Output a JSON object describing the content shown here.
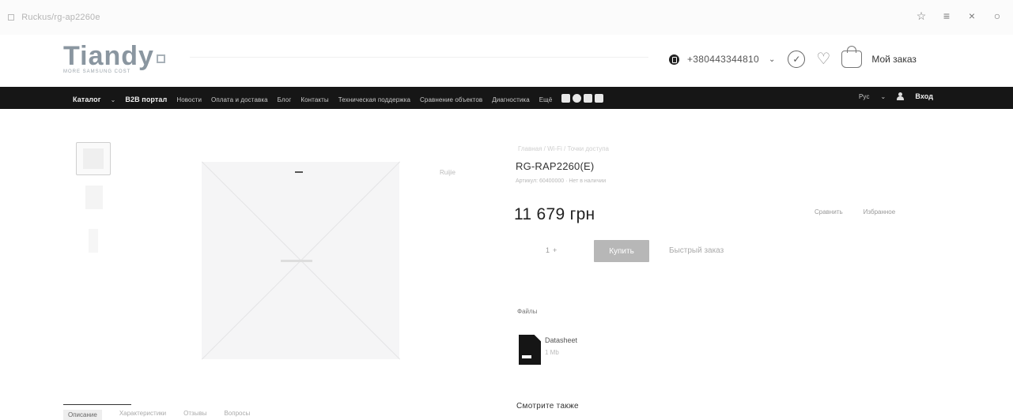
{
  "browser": {
    "url_text": "Ruckus/rg-ap2260e"
  },
  "header": {
    "logo_text": "Tiandy",
    "logo_tagline": "MORE SAMSUNG COST",
    "phone": "+380443344810",
    "my_order": "Мой заказ"
  },
  "nav": {
    "catalog": "Каталог",
    "items": [
      "B2B портал",
      "Новости",
      "Оплата и доставка",
      "Блог",
      "Контакты",
      "Техническая поддержка",
      "Сравнение объектов",
      "Диагностика",
      "Ещё"
    ],
    "lang": "Рус",
    "login": "Вход"
  },
  "product": {
    "breadcrumb": "Главная / Wi-Fi / Точки доступа",
    "title": "RG-RAP2260(E)",
    "subtitle": "Артикул: 60400000 · Нет в наличии",
    "price": "11 679 грн",
    "compare": "Сравнить",
    "favorite": "Избранное",
    "qty": "1",
    "buy": "Купить",
    "fast_order": "Быстрый заказ",
    "image_label": "Ruijie",
    "files_label": "Файлы",
    "file_name": "Datasheet",
    "file_size": "1 Mb",
    "see_also": "Смотрите также"
  },
  "tabs": [
    "Описание",
    "Характеристики",
    "Отзывы",
    "Вопросы"
  ]
}
